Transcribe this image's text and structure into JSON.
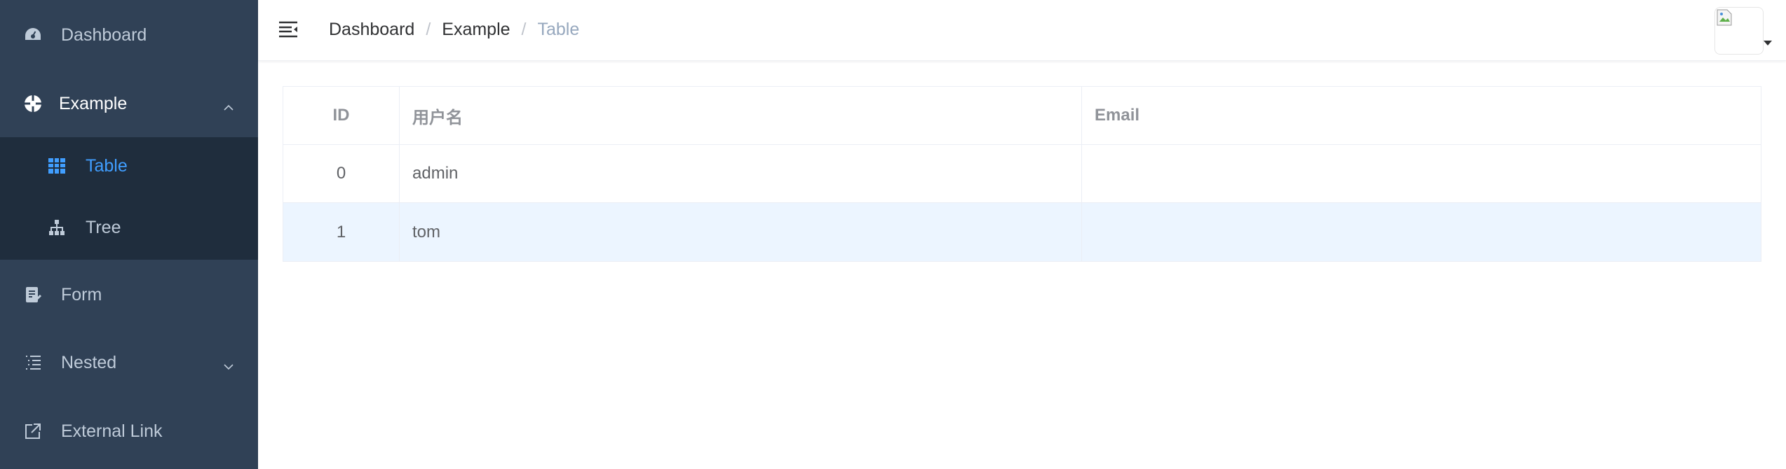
{
  "sidebar": {
    "items": [
      {
        "label": "Dashboard",
        "icon": "dashboard-icon"
      },
      {
        "label": "Example",
        "icon": "example-icon",
        "expanded": true
      },
      {
        "label": "Table",
        "icon": "table-icon",
        "active": true
      },
      {
        "label": "Tree",
        "icon": "tree-icon"
      },
      {
        "label": "Form",
        "icon": "form-icon"
      },
      {
        "label": "Nested",
        "icon": "nested-icon",
        "expanded": false
      },
      {
        "label": "External Link",
        "icon": "link-icon"
      }
    ],
    "colors": {
      "bg": "#304156",
      "submenu_bg": "#1f2d3d",
      "text": "#bfcbd9",
      "active": "#409eff"
    }
  },
  "navbar": {
    "breadcrumb": [
      "Dashboard",
      "Example",
      "Table"
    ],
    "separator": "/"
  },
  "table": {
    "columns": [
      "ID",
      "用户名",
      "Email"
    ],
    "rows": [
      {
        "id": "0",
        "username": "admin",
        "email": ""
      },
      {
        "id": "1",
        "username": "tom",
        "email": ""
      }
    ],
    "highlight_color": "#ecf5ff"
  }
}
